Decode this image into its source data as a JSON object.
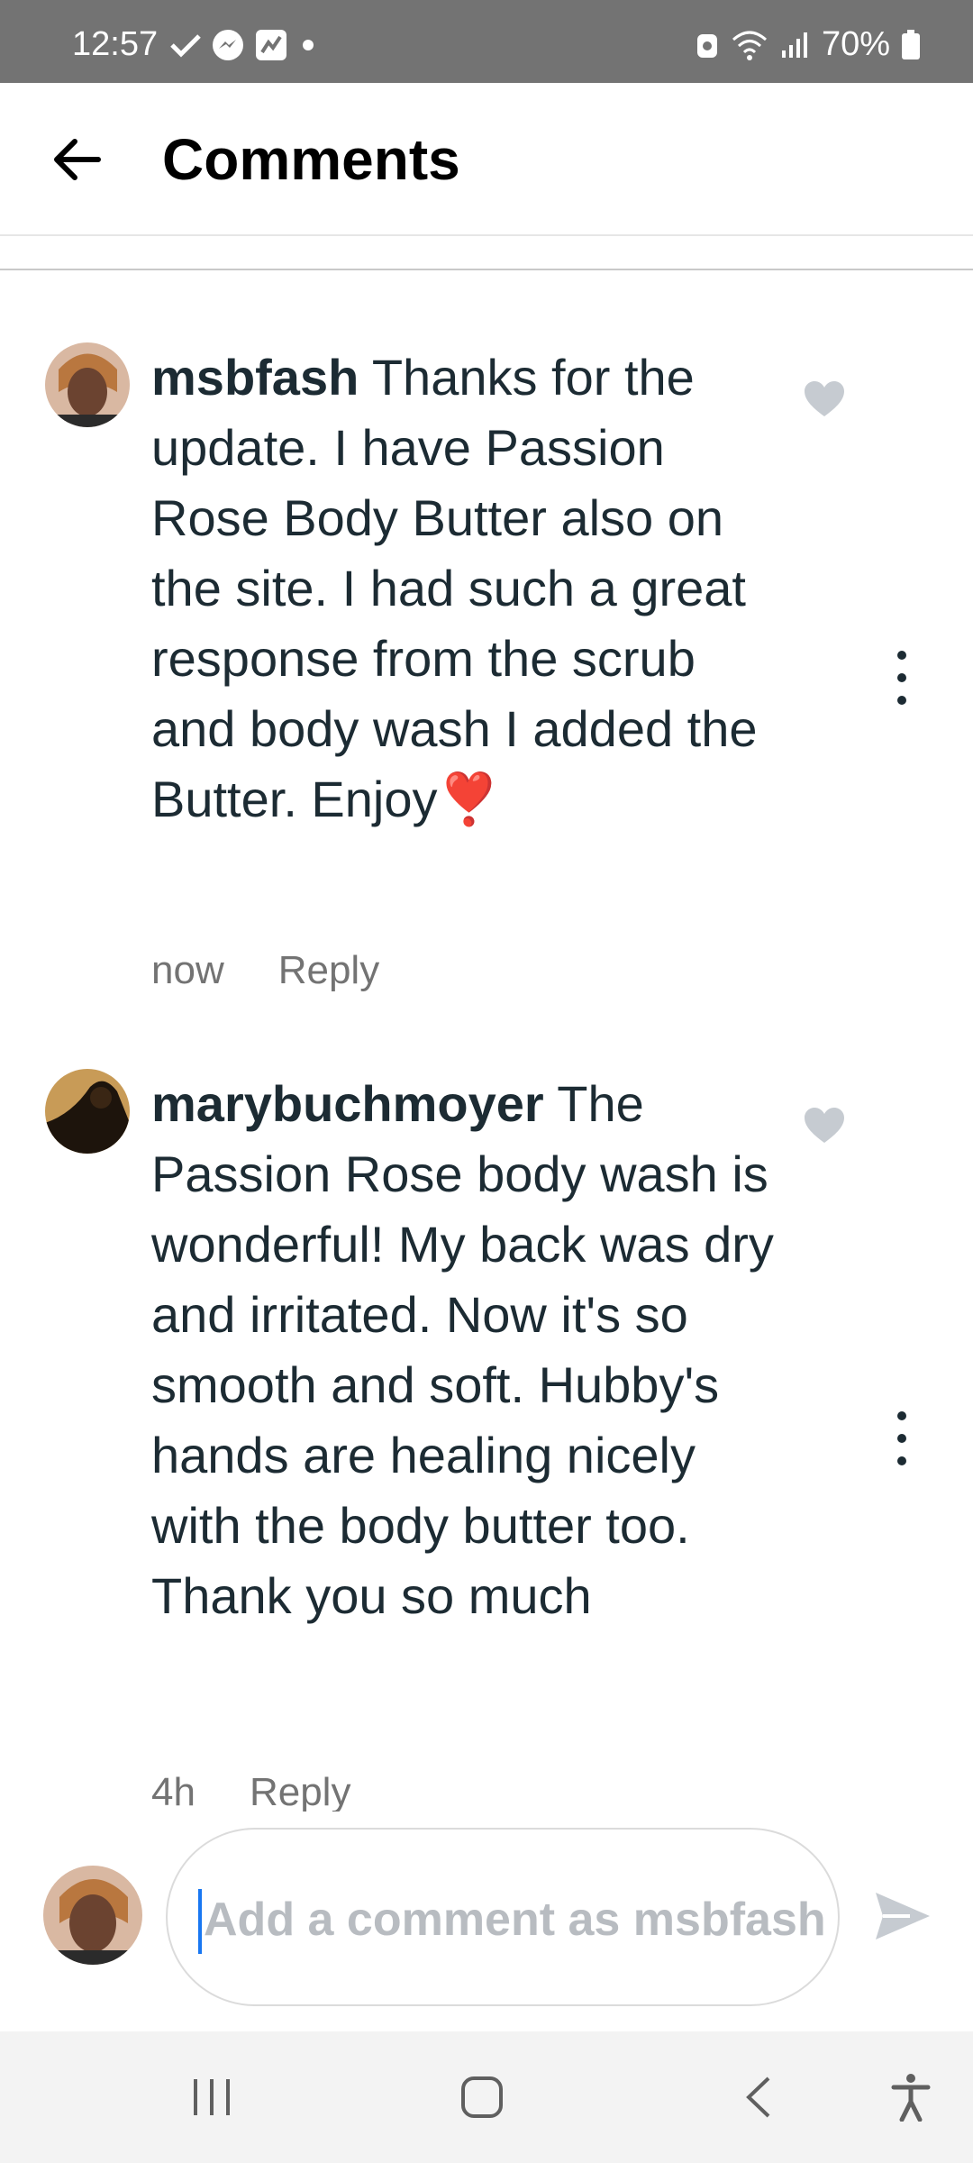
{
  "status_bar": {
    "time": "12:57",
    "battery": "70%"
  },
  "header": {
    "title": "Comments"
  },
  "comments": [
    {
      "username": "msbfash",
      "text": " Thanks for the update. I have  Passion Rose Body Butter also on the site. I had such a great response from the scrub and body wash I added the Butter. Enjoy",
      "emoji": "❣️",
      "time": "now",
      "reply_label": "Reply"
    },
    {
      "username": "marybuchmoyer",
      "text": " The Passion Rose body wash is wonderful! My back was dry and irritated. Now it's so smooth and soft. Hubby's hands are healing nicely with the body butter too. Thank you so much",
      "time": "4h",
      "reply_label": "Reply"
    }
  ],
  "composer": {
    "placeholder": "Add a comment as msbfash"
  },
  "colors": {
    "status_bar": "#737373",
    "text": "#1c2b33",
    "muted": "#737373",
    "caret": "#1877f2",
    "heart": "#c6cbd1"
  }
}
